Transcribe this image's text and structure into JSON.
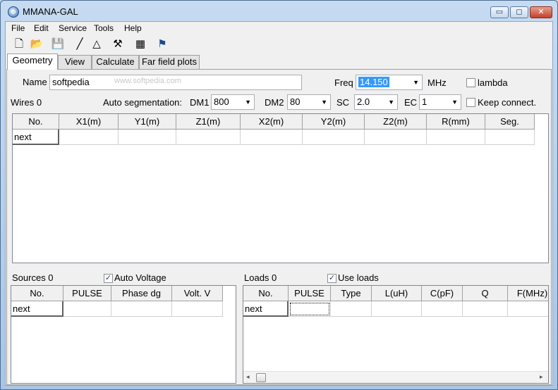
{
  "window": {
    "title": "MMANA-GAL",
    "min": "▭",
    "max": "◻",
    "close": "✕"
  },
  "menu": [
    "File",
    "Edit",
    "Service",
    "Tools",
    "Help"
  ],
  "toolbar_icons": [
    "new-file-icon",
    "open-folder-icon",
    "save-disk-icon",
    "draw-wire-icon",
    "triangle-icon",
    "tools-icon",
    "calculator-icon",
    "antenna-icon"
  ],
  "toolbar_glyphs": [
    "🗋",
    "📂",
    "💾",
    "╱",
    "△",
    "⚒",
    "▦",
    "⚑"
  ],
  "tabs": [
    "Geometry",
    "View",
    "Calculate",
    "Far field plots"
  ],
  "geometry": {
    "name_label": "Name",
    "name_value": "softpedia",
    "watermark": "www.softpedia.com",
    "freq_label": "Freq",
    "freq_value": "14.150",
    "freq_unit": "MHz",
    "lambda_label": "lambda",
    "wires_label": "Wires 0",
    "auto_seg_label": "Auto segmentation:",
    "dm1_label": "DM1",
    "dm1_value": "800",
    "dm2_label": "DM2",
    "dm2_value": "80",
    "sc_label": "SC",
    "sc_value": "2.0",
    "ec_label": "EC",
    "ec_value": "1",
    "keep_connect_label": "Keep connect."
  },
  "wires_table": {
    "columns": [
      "No.",
      "X1(m)",
      "Y1(m)",
      "Z1(m)",
      "X2(m)",
      "Y2(m)",
      "Z2(m)",
      "R(mm)",
      "Seg."
    ],
    "rows": [
      [
        "next",
        "",
        "",
        "",
        "",
        "",
        "",
        "",
        ""
      ]
    ]
  },
  "sources": {
    "label": "Sources 0",
    "auto_voltage_label": "Auto Voltage",
    "auto_voltage_checked": true,
    "columns": [
      "No.",
      "PULSE",
      "Phase dg",
      "Volt. V"
    ],
    "rows": [
      [
        "next",
        "",
        "",
        ""
      ]
    ]
  },
  "loads": {
    "label": "Loads 0",
    "use_loads_label": "Use loads",
    "use_loads_checked": true,
    "columns": [
      "No.",
      "PULSE",
      "Type",
      "L(uH)",
      "C(pF)",
      "Q",
      "F(MHz)"
    ],
    "rows": [
      [
        "next",
        "",
        "",
        "",
        "",
        "",
        ""
      ]
    ]
  },
  "check_mark": "✓",
  "arrow_down": "▼",
  "arrow_left": "◂",
  "arrow_right": "▸"
}
